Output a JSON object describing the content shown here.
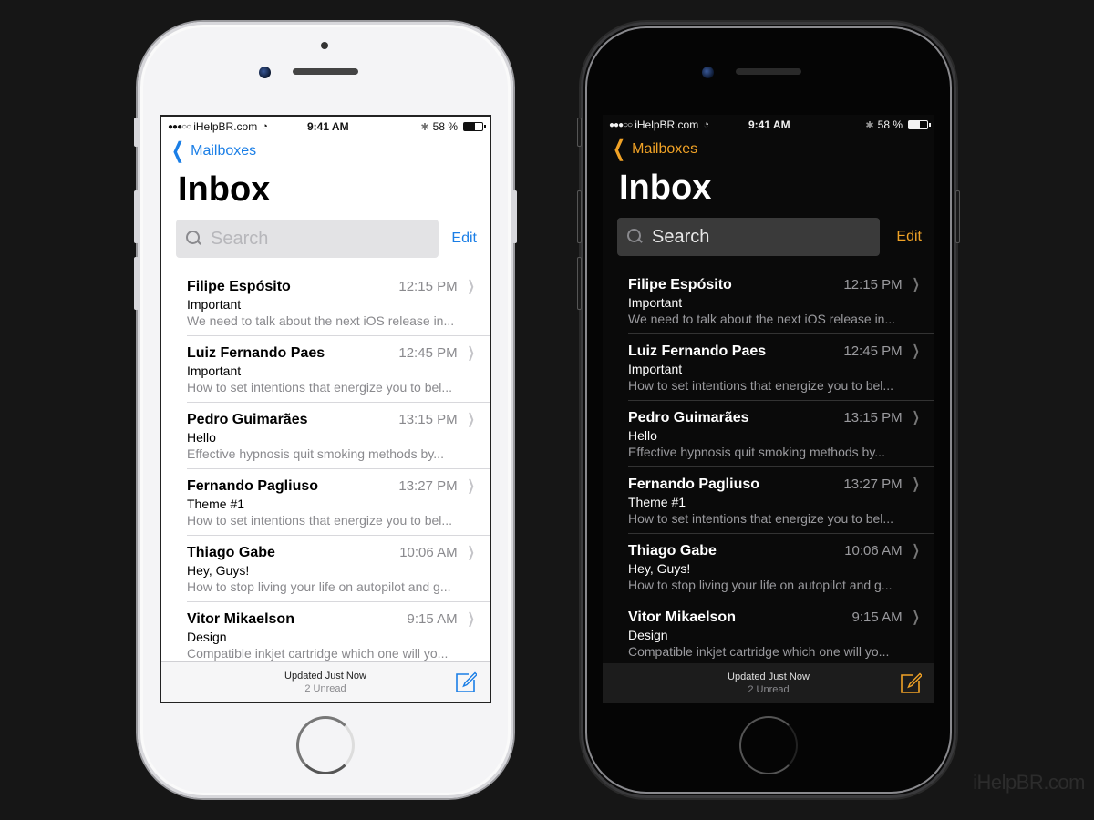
{
  "watermark": "iHelpBR.com",
  "themes": {
    "light": {
      "accent": "#1a7ee6"
    },
    "dark": {
      "accent": "#f0a226"
    }
  },
  "status_bar": {
    "signal": "●●●○○",
    "carrier": "iHelpBR.com",
    "wifi_icon": "wifi-icon",
    "time": "9:41 AM",
    "bluetooth_icon": "bluetooth-icon",
    "battery_label": "58 %",
    "battery_percent": 58
  },
  "nav": {
    "back_icon": "chevron-left-icon",
    "back_label": "Mailboxes"
  },
  "title": "Inbox",
  "search": {
    "placeholder": "Search",
    "icon": "search-icon"
  },
  "edit_label": "Edit",
  "emails": [
    {
      "sender": "Filipe Espósito",
      "time": "12:15 PM",
      "subject": "Important",
      "preview": "We need to talk about the next iOS release in..."
    },
    {
      "sender": "Luiz Fernando Paes",
      "time": "12:45 PM",
      "subject": "Important",
      "preview": "How to set intentions that energize you to bel..."
    },
    {
      "sender": "Pedro Guimarães",
      "time": "13:15 PM",
      "subject": "Hello",
      "preview": "Effective hypnosis quit smoking methods by..."
    },
    {
      "sender": "Fernando Pagliuso",
      "time": "13:27 PM",
      "subject": "Theme #1",
      "preview": "How to set intentions that energize you to bel..."
    },
    {
      "sender": "Thiago Gabe",
      "time": "10:06 AM",
      "subject": "Hey, Guys!",
      "preview": "How to stop living your life on autopilot and g..."
    },
    {
      "sender": "Vitor Mikaelson",
      "time": "9:15 AM",
      "subject": "Design",
      "preview": "Compatible inkjet cartridge which one will yo..."
    }
  ],
  "toolbar": {
    "updated": "Updated Just Now",
    "unread": "2 Unread",
    "compose_icon": "compose-icon"
  }
}
